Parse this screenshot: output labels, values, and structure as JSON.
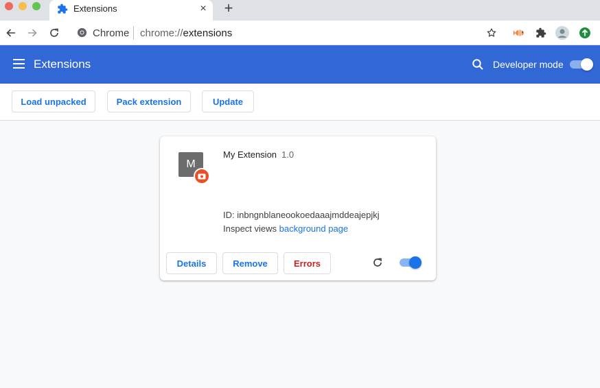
{
  "tab": {
    "title": "Extensions",
    "close_glyph": "×",
    "favicon": "puzzle-icon"
  },
  "newtab_glyph": "+",
  "omnibox": {
    "site_label": "Chrome",
    "url_scheme": "chrome://",
    "url_path": "extensions"
  },
  "header": {
    "title": "Extensions",
    "developer_mode_label": "Developer mode",
    "developer_mode_on": true
  },
  "actions": {
    "load_unpacked": "Load unpacked",
    "pack_extension": "Pack extension",
    "update": "Update"
  },
  "extension": {
    "icon_letter": "M",
    "name": "My Extension",
    "version": "1.0",
    "id_label": "ID: inbngnblaneookoedaaajmddeajepjkj",
    "inspect_label": "Inspect views",
    "inspect_link": "background page",
    "details_label": "Details",
    "remove_label": "Remove",
    "errors_label": "Errors",
    "enabled": true
  },
  "colors": {
    "header_blue": "#3267d6",
    "accent_blue": "#1a73e8",
    "error_red": "#c5221f",
    "badge_orange": "#ea4f27"
  }
}
